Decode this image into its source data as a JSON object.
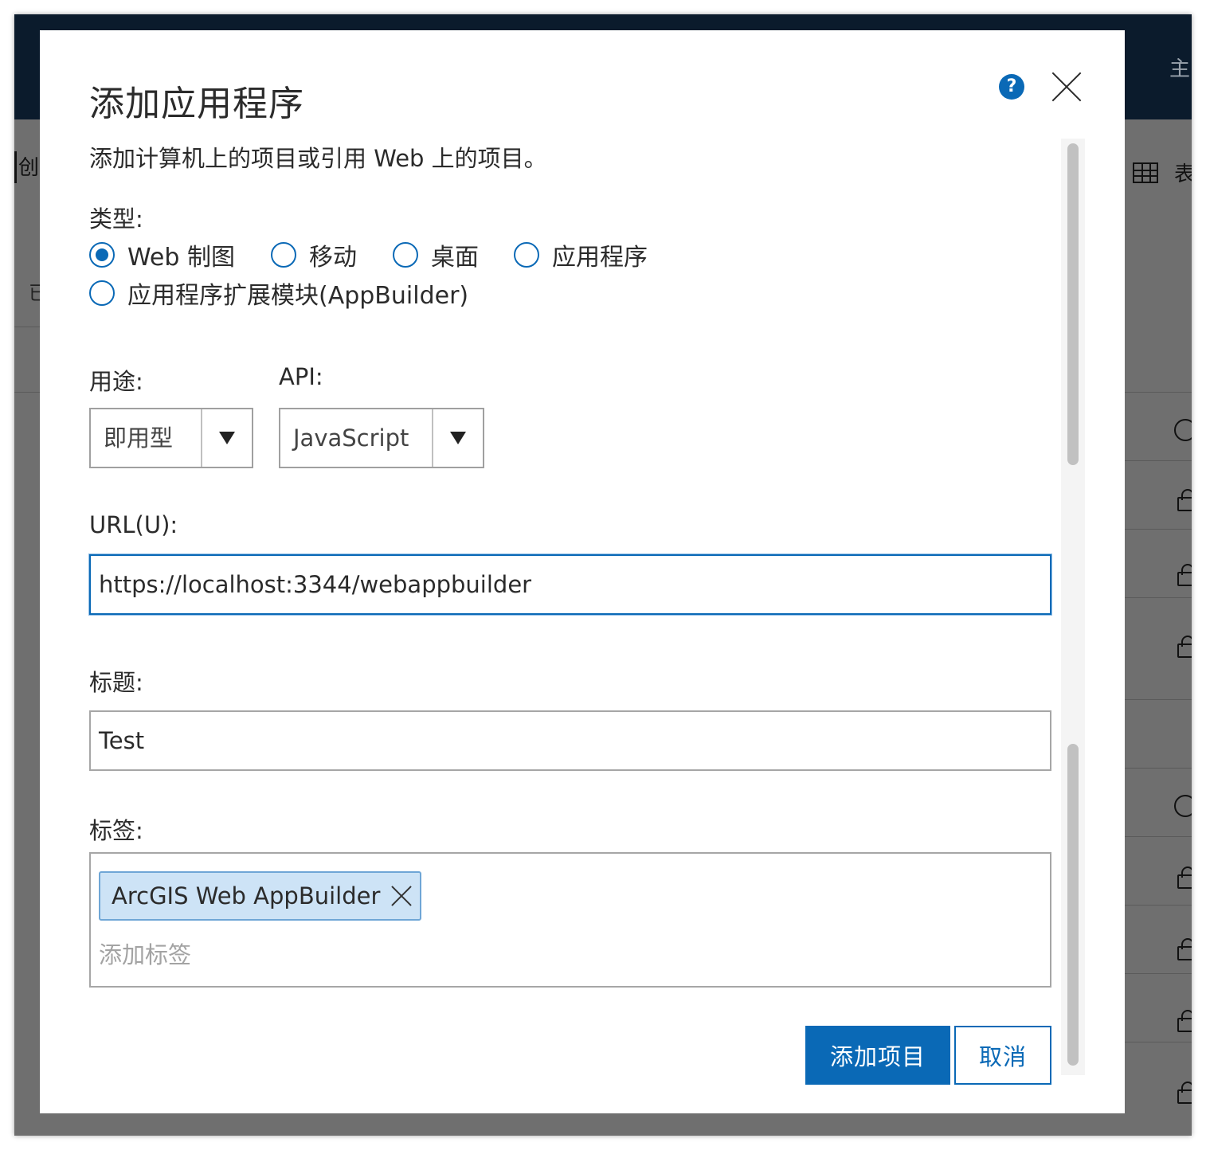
{
  "background": {
    "topbar_text": "主",
    "left_tab": "创建",
    "left_row": "已",
    "right_label": "表"
  },
  "dialog": {
    "title": "添加应用程序",
    "description": "添加计算机上的项目或引用 Web 上的项目。",
    "type": {
      "label": "类型:",
      "options": [
        "Web 制图",
        "移动",
        "桌面",
        "应用程序",
        "应用程序扩展模块(AppBuilder)"
      ],
      "selected": "Web 制图"
    },
    "purpose": {
      "label": "用途:",
      "value": "即用型"
    },
    "api": {
      "label": "API:",
      "value": "JavaScript"
    },
    "url": {
      "label": "URL(U):",
      "value": "https://localhost:3344/webappbuilder"
    },
    "title_field": {
      "label": "标题:",
      "value": "Test"
    },
    "tags": {
      "label": "标签:",
      "items": [
        "ArcGIS Web AppBuilder"
      ],
      "placeholder": "添加标签"
    },
    "buttons": {
      "add": "添加项目",
      "cancel": "取消"
    }
  },
  "icons": {
    "help": "help-icon",
    "close": "close-icon",
    "tag_remove": "close-icon",
    "dropdown": "chevron-down-icon"
  },
  "colors": {
    "accent": "#0a69b6",
    "tag_bg": "#cde3f6",
    "tag_border": "#6fa6d6",
    "overlay": "#6f6f6f",
    "header": "#0b1b2c"
  }
}
